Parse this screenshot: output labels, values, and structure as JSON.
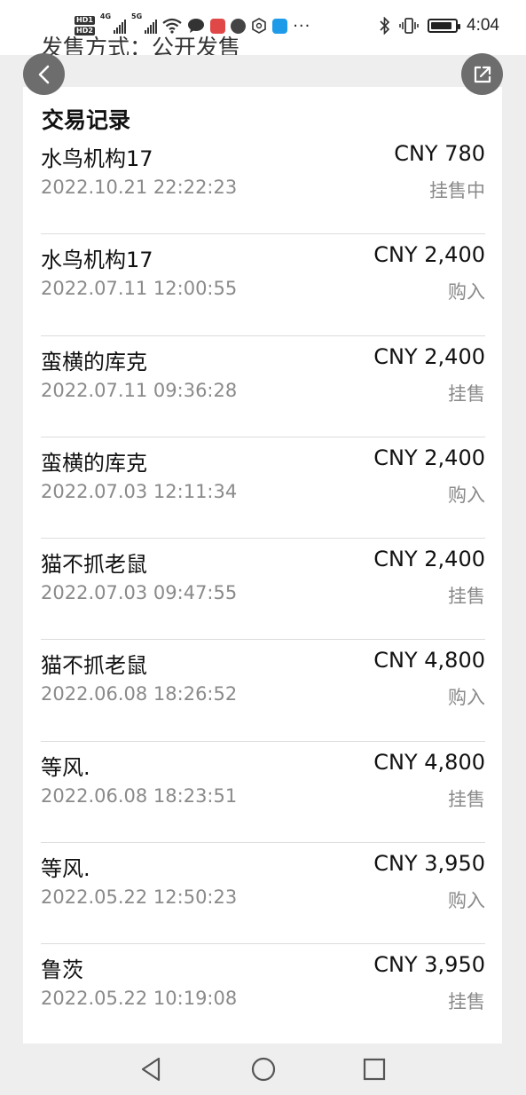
{
  "status_bar": {
    "hd_labels": [
      "HD1",
      "HD2"
    ],
    "network_labels": [
      "4G",
      "5G"
    ],
    "more": "···",
    "time": "4:04",
    "icons": [
      "hd-icon",
      "signal-icon",
      "wifi-icon",
      "chat-icon",
      "app-icon",
      "app-icon",
      "app-icon",
      "app-icon",
      "bluetooth-icon",
      "vibrate-icon",
      "battery-icon"
    ]
  },
  "partial_header": "发售方式：公开发售",
  "section_title": "交易记录",
  "records": [
    {
      "name": "水鸟机构17",
      "price": "CNY 780",
      "time": "2022.10.21 22:22:23",
      "status": "挂售中"
    },
    {
      "name": "水鸟机构17",
      "price": "CNY 2,400",
      "time": "2022.07.11 12:00:55",
      "status": "购入"
    },
    {
      "name": "蛮横的库克",
      "price": "CNY 2,400",
      "time": "2022.07.11 09:36:28",
      "status": "挂售"
    },
    {
      "name": "蛮横的库克",
      "price": "CNY 2,400",
      "time": "2022.07.03 12:11:34",
      "status": "购入"
    },
    {
      "name": "猫不抓老鼠",
      "price": "CNY 2,400",
      "time": "2022.07.03 09:47:55",
      "status": "挂售"
    },
    {
      "name": "猫不抓老鼠",
      "price": "CNY 4,800",
      "time": "2022.06.08 18:26:52",
      "status": "购入"
    },
    {
      "name": "等风.",
      "price": "CNY 4,800",
      "time": "2022.06.08 18:23:51",
      "status": "挂售"
    },
    {
      "name": "等风.",
      "price": "CNY 3,950",
      "time": "2022.05.22 12:50:23",
      "status": "购入"
    },
    {
      "name": "鲁茨",
      "price": "CNY 3,950",
      "time": "2022.05.22 10:19:08",
      "status": "挂售"
    }
  ],
  "colors": {
    "fab": "#6d6d6d",
    "muted_text": "#8a8a8a",
    "divider": "#dcdcdc"
  }
}
